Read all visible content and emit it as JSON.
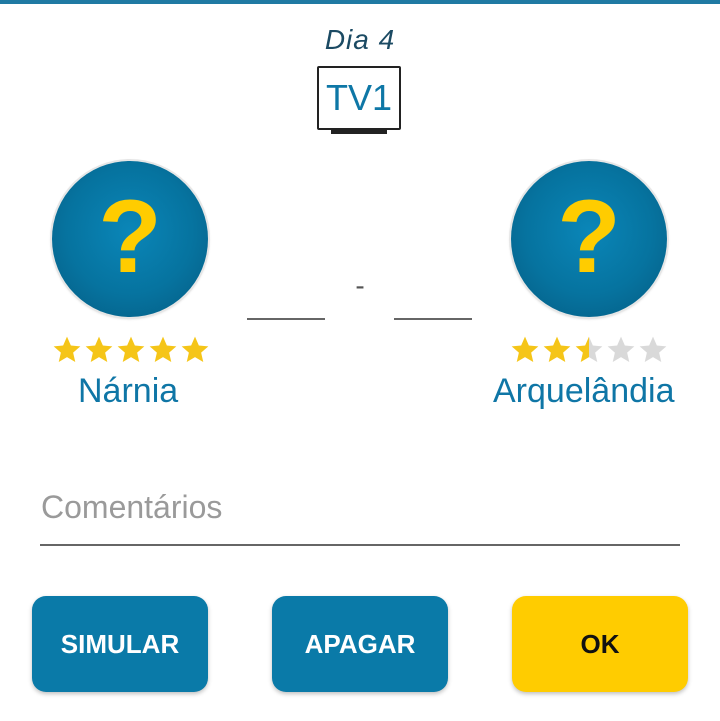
{
  "header": {
    "day_label": "Dia  4",
    "channel": "TV1"
  },
  "match": {
    "home": {
      "name": "Nárnia",
      "logo_symbol": "?",
      "rating": 5,
      "rating_max": 5,
      "score_value": ""
    },
    "away": {
      "name": "Arquelândia",
      "logo_symbol": "?",
      "rating": 2.5,
      "rating_max": 5,
      "score_value": ""
    },
    "separator": "-"
  },
  "comments": {
    "placeholder": "Comentários",
    "value": ""
  },
  "buttons": {
    "simulate_label": "SIMULAR",
    "clear_label": "APAGAR",
    "ok_label": "OK"
  },
  "colors": {
    "brand_blue": "#0a7aa8",
    "accent_yellow": "#ffcc00",
    "star_filled": "#f5c518",
    "star_empty": "#d9d9d9",
    "team_name": "#0f76a6"
  },
  "icons": {
    "tv": "tv-icon",
    "star": "star-icon",
    "team_logo": "question-mark-logo"
  }
}
